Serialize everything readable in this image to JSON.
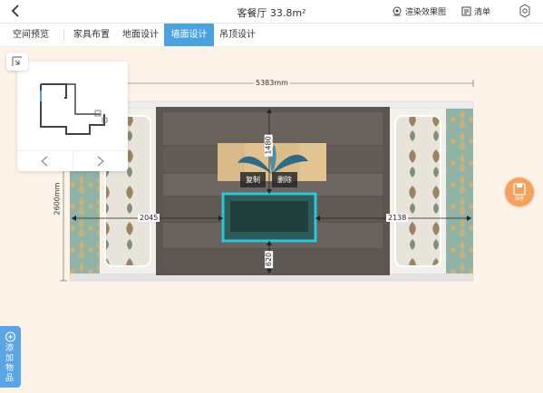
{
  "header": {
    "title": "客餐厅 33.8m²",
    "render_label": "渲染效果图",
    "list_label": "清单"
  },
  "tabs": [
    {
      "label": "空间预览",
      "active": false
    },
    {
      "label": "家具布置",
      "active": false
    },
    {
      "label": "地面设计",
      "active": false
    },
    {
      "label": "墙面设计",
      "active": true
    },
    {
      "label": "吊顶设计",
      "active": false
    }
  ],
  "dimensions": {
    "width_total": "5383mm",
    "height_total": "2600mm",
    "left_gap": "2045",
    "right_gap": "2138",
    "top_gap": "1480",
    "bottom_gap": "620"
  },
  "context_menu": {
    "copy": "复制",
    "delete": "删除"
  },
  "save": {
    "label": "保存"
  },
  "add_panel": {
    "label": "添加物品"
  },
  "colors": {
    "accent": "#4aa3e0",
    "save": "#f6a25a",
    "selection": "#2cc6d8",
    "background": "#fdf3e9"
  }
}
